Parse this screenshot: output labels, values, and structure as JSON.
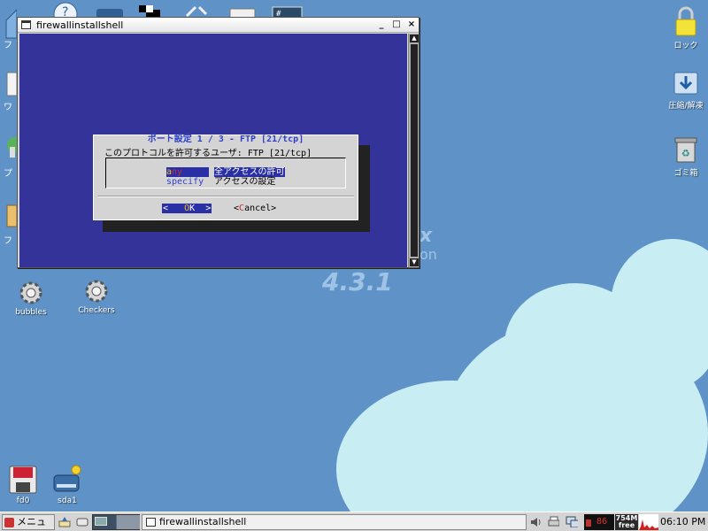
{
  "desktop": {
    "logo": {
      "fragment": "x",
      "subtitle_fragment": "on",
      "version": "4.3.1"
    },
    "icons_left_clipped": [
      {
        "name": "folder",
        "label": "フ"
      },
      {
        "name": "doc",
        "label": "ワ"
      },
      {
        "name": "paint",
        "label": "プ"
      },
      {
        "name": "clipboard",
        "label": "フ"
      }
    ],
    "icons_left": [
      {
        "id": "bubbles",
        "label": "bubbles"
      },
      {
        "id": "checkers",
        "label": "Checkers"
      },
      {
        "id": "fd0",
        "label": "fd0"
      },
      {
        "id": "sda1",
        "label": "sda1"
      }
    ],
    "icons_right": [
      {
        "id": "lock",
        "label": "ロック"
      },
      {
        "id": "archive",
        "label": "圧縮/解凍"
      },
      {
        "id": "trash",
        "label": "ゴミ箱"
      }
    ]
  },
  "window": {
    "title": "firewallinstallshell",
    "minimize": "_",
    "maximize": "□",
    "close": "×"
  },
  "dialog": {
    "title": "ポート設定 1 / 3 - FTP [21/tcp]",
    "prompt": "このプロトコルを許可するユーザ: FTP [21/tcp]",
    "options": [
      {
        "tag": "any",
        "description": "全アクセスの許可",
        "selected": true
      },
      {
        "tag": "specify",
        "description": "アクセスの設定",
        "selected": false
      }
    ],
    "ok": {
      "left": "<",
      "hotkey": "O",
      "rest": "K",
      "right": ">"
    },
    "cancel": {
      "left": "<",
      "hotkey": "C",
      "rest": "ancel",
      "right": ">"
    }
  },
  "taskbar": {
    "menu_label": "メニュー",
    "task_title": "firewallinstallshell",
    "cpu_text": "86",
    "memory_value": "754M",
    "memory_label": "free",
    "clock": "06:10 PM"
  },
  "colors": {
    "desktop_bg": "#5f93c8",
    "terminal_bg": "#33339a",
    "dialog_title": "#2c3fd0",
    "selection": "#2a2fa6"
  }
}
